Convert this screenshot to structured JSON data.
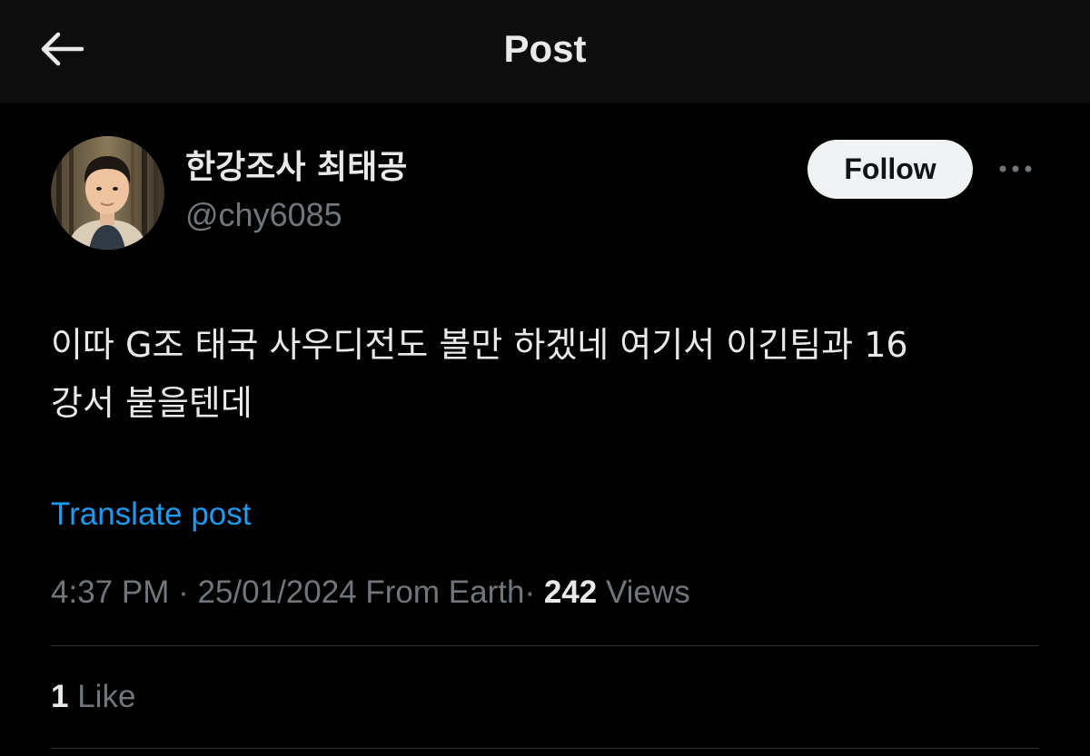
{
  "header": {
    "title": "Post",
    "back_icon": "arrow-left-icon"
  },
  "author": {
    "display_name": "한강조사 최태공",
    "handle": "@chy6085",
    "avatar_icon": "avatar-photo"
  },
  "follow_button": {
    "label": "Follow"
  },
  "more_icon": "more-horizontal-icon",
  "post": {
    "text": "이따 G조 태국 사우디전도 볼만 하겠네 여기서 이긴팀과 16\n강서 붙을텐데"
  },
  "translate": {
    "label": "Translate post"
  },
  "meta": {
    "time": "4:37 PM",
    "separator": "·",
    "date": "25/01/2024",
    "location": "From Earth",
    "views_count": "242",
    "views_label": "Views"
  },
  "likes": {
    "count": "1",
    "label": "Like"
  },
  "colors": {
    "background": "#000000",
    "header_background": "#0d0d0d",
    "primary_text": "#e7e9ea",
    "secondary_text": "#71767b",
    "link": "#1d9bf0",
    "divider": "#2f3336",
    "follow_button_bg": "#eff3f4"
  }
}
